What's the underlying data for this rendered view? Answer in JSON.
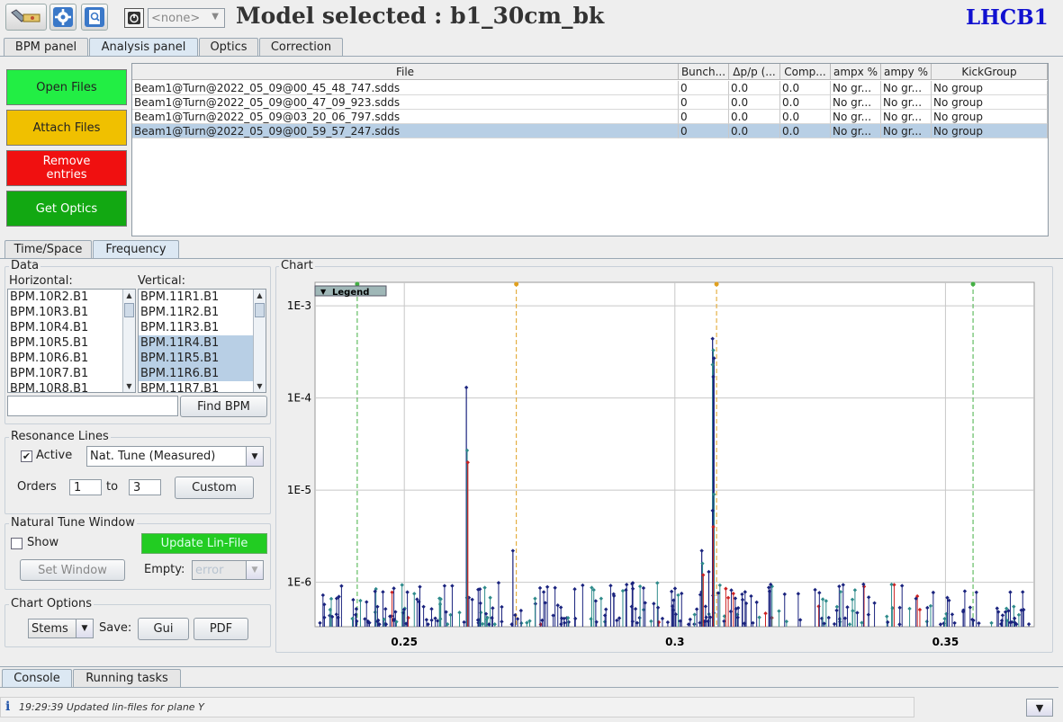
{
  "toolbar": {
    "model_combo_value": "<none>",
    "model_title": "Model selected : b1_30cm_bk",
    "beam_label": "LHCB1"
  },
  "main_tabs": [
    "BPM panel",
    "Analysis panel",
    "Optics",
    "Correction"
  ],
  "actions": {
    "open_files": "Open Files",
    "attach_files": "Attach Files",
    "remove_entries": "Remove entries",
    "get_optics": "Get Optics"
  },
  "file_table": {
    "headers": [
      "File",
      "Bunch...",
      "Δp/p (...",
      "Comp...",
      "ampx %",
      "ampy %",
      "KickGroup"
    ],
    "rows": [
      [
        "Beam1@Turn@2022_05_09@00_45_48_747.sdds",
        "0",
        "0.0",
        "0.0",
        "No gr...",
        "No gr...",
        "No group"
      ],
      [
        "Beam1@Turn@2022_05_09@00_47_09_923.sdds",
        "0",
        "0.0",
        "0.0",
        "No gr...",
        "No gr...",
        "No group"
      ],
      [
        "Beam1@Turn@2022_05_09@03_20_06_797.sdds",
        "0",
        "0.0",
        "0.0",
        "No gr...",
        "No gr...",
        "No group"
      ],
      [
        "Beam1@Turn@2022_05_09@00_59_57_247.sdds",
        "0",
        "0.0",
        "0.0",
        "No gr...",
        "No gr...",
        "No group"
      ]
    ],
    "selected_row": 3
  },
  "sub_tabs": [
    "Time/Space",
    "Frequency"
  ],
  "data_group": {
    "title": "Data",
    "horizontal_label": "Horizontal:",
    "vertical_label": "Vertical:",
    "horizontal": [
      "BPM.10R2.B1",
      "BPM.10R3.B1",
      "BPM.10R4.B1",
      "BPM.10R5.B1",
      "BPM.10R6.B1",
      "BPM.10R7.B1",
      "BPM.10R8.B1"
    ],
    "vertical": [
      "BPM.11R1.B1",
      "BPM.11R2.B1",
      "BPM.11R3.B1",
      "BPM.11R4.B1",
      "BPM.11R5.B1",
      "BPM.11R6.B1",
      "BPM.11R7.B1"
    ],
    "vertical_selected": [
      3,
      4,
      5
    ],
    "find_bpm": "Find BPM"
  },
  "resonance": {
    "title": "Resonance Lines",
    "active_label": "Active",
    "active_checked": true,
    "tune_combo": "Nat. Tune (Measured)",
    "orders_label": "Orders",
    "order_from": "1",
    "to_label": "to",
    "order_to": "3",
    "custom": "Custom"
  },
  "tune_window": {
    "title": "Natural Tune Window",
    "show_label": "Show",
    "show_checked": false,
    "update_lin": "Update Lin-File",
    "set_window": "Set Window",
    "empty_label": "Empty:",
    "empty_value": "error"
  },
  "chart_options": {
    "title": "Chart Options",
    "style_combo": "Stems",
    "save_label": "Save:",
    "gui": "Gui",
    "pdf": "PDF"
  },
  "chart_panel": {
    "title": "Chart",
    "legend_label": "Legend"
  },
  "chart_data": {
    "type": "scatter",
    "subtype": "stem",
    "y_scale": "log",
    "xlim": [
      0.2335,
      0.3664
    ],
    "ylim": [
      3.3e-07,
      0.0018
    ],
    "x_ticks": [
      0.25,
      0.3,
      0.35
    ],
    "x_tick_labels": [
      "0.25",
      "0.3",
      "0.35"
    ],
    "y_ticks": [
      1e-06,
      1e-05,
      0.0001,
      0.001
    ],
    "y_tick_labels": [
      "1E-6",
      "1E-5",
      "1E-4",
      "1E-3"
    ],
    "grid": true,
    "legend_placement": "top-left",
    "resonance_lines": [
      {
        "x": 0.2413,
        "color": "#44b044"
      },
      {
        "x": 0.2707,
        "color": "#e0a020"
      },
      {
        "x": 0.3077,
        "color": "#e0a020"
      },
      {
        "x": 0.3551,
        "color": "#44b044"
      }
    ],
    "major_peaks": [
      {
        "x": 0.2616,
        "values": [
          0.00013,
          2.7e-05,
          2e-05
        ]
      },
      {
        "x": 0.2702,
        "values": [
          2.2e-06
        ]
      },
      {
        "x": 0.2998,
        "values": [
          5e-07
        ]
      },
      {
        "x": 0.3003,
        "values": [
          4.5e-07
        ]
      },
      {
        "x": 0.3011,
        "values": [
          3.8e-07
        ]
      },
      {
        "x": 0.3051,
        "values": [
          2.2e-06,
          1.6e-06,
          1.2e-06
        ]
      },
      {
        "x": 0.3064,
        "values": [
          1.3e-06
        ]
      },
      {
        "x": 0.3071,
        "values": [
          0.00044,
          0.00033,
          0.00027,
          0.00023,
          0.00017,
          9e-06,
          6e-06,
          4e-06
        ]
      }
    ],
    "noise_floor_range": [
      3.5e-07,
      1e-06
    ],
    "series_colors": [
      "#1a237e",
      "#2e8b8b",
      "#cc2222"
    ]
  },
  "bottom_tabs": [
    "Console",
    "Running tasks"
  ],
  "status": {
    "icon": "i",
    "message": "19:29:39 Updated lin-files for plane Y"
  }
}
